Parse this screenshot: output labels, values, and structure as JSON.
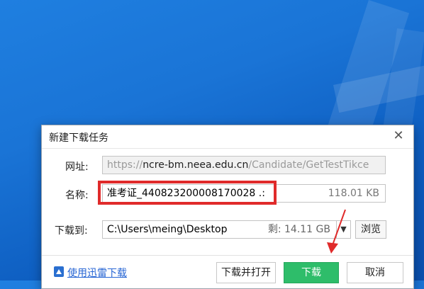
{
  "dialog": {
    "title": "新建下载任务",
    "url_label": "网址:",
    "url_prefix": "https://",
    "url_domain": "ncre-bm.neea.edu.cn",
    "url_path": "/Candidate/GetTestTikce",
    "name_label": "名称:",
    "file_name": "准考证_440823200008170028 .:",
    "file_size": "118.01 KB",
    "save_label": "下载到:",
    "save_path": "C:\\Users\\meing\\Desktop",
    "free_space": "剩: 14.11 GB",
    "browse_label": "浏览",
    "xunlei_link": "使用迅雷下载",
    "open_after_label": "下载并打开",
    "download_label": "下载",
    "cancel_label": "取消",
    "close_glyph": "✕",
    "dropdown_glyph": "▼"
  },
  "colors": {
    "highlight": "#e02b2b",
    "download_button": "#2ebd6a",
    "link": "#2866d4",
    "wallpaper": "#1a74d6"
  },
  "icons": [
    "close-icon",
    "chevron-down-icon",
    "xunlei-icon",
    "red-arrow-annotation"
  ]
}
